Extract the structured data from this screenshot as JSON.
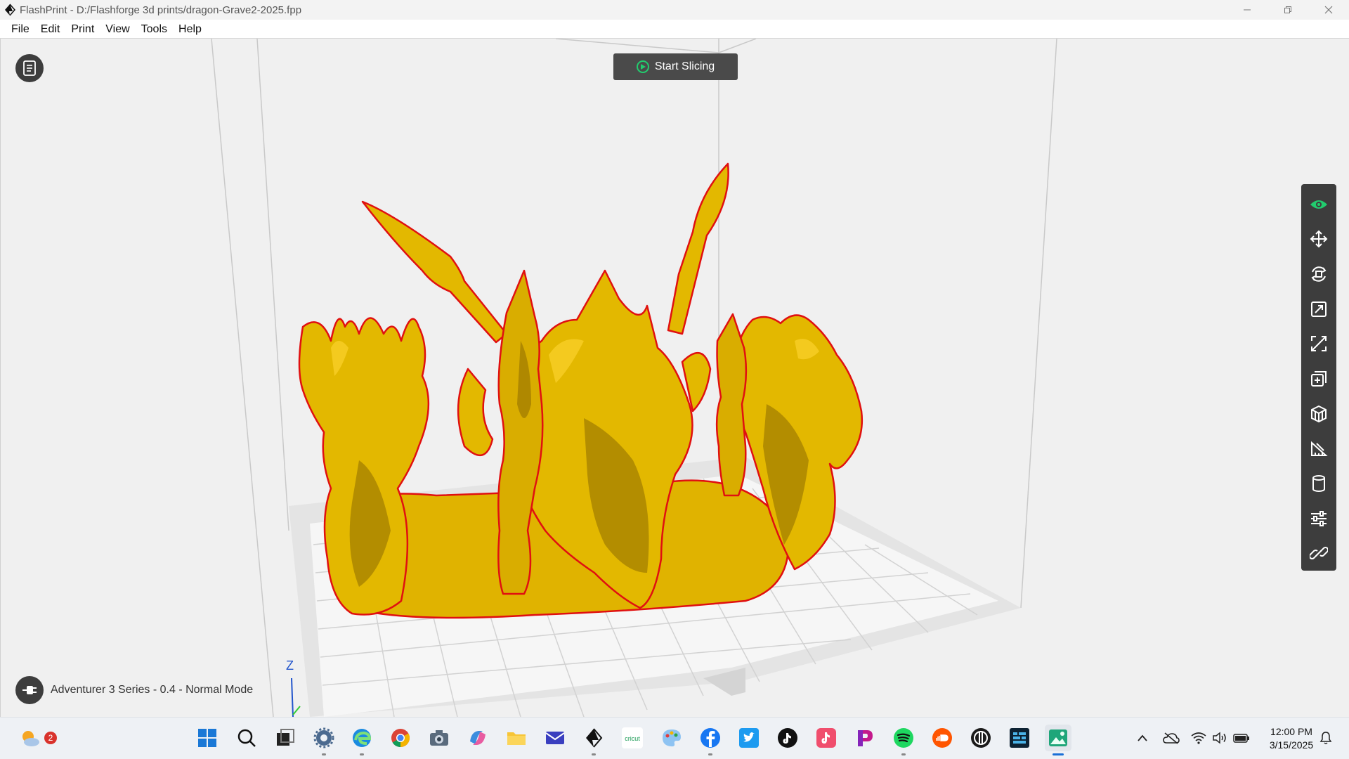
{
  "window": {
    "title": "FlashPrint - D:/Flashforge 3d prints/dragon-Grave2-2025.fpp",
    "minimize_icon": "minimize-icon",
    "restore_icon": "restore-icon",
    "close_icon": "close-icon"
  },
  "menu": {
    "items": [
      {
        "label": "File"
      },
      {
        "label": "Edit"
      },
      {
        "label": "Print"
      },
      {
        "label": "View"
      },
      {
        "label": "Tools"
      },
      {
        "label": "Help"
      }
    ]
  },
  "viewport": {
    "start_slicing_label": "Start Slicing",
    "machine_info": "Adventurer 3 Series - 0.4 - Normal Mode",
    "axis_z_label": "Z",
    "model_color": "#e3b800",
    "model_outline_color": "#e01010",
    "accent_color": "#22cc6e"
  },
  "toolbar": {
    "tools": [
      {
        "name": "view",
        "icon": "eye-icon",
        "active": true
      },
      {
        "name": "move",
        "icon": "move-icon"
      },
      {
        "name": "rotate",
        "icon": "rotate-icon"
      },
      {
        "name": "scale",
        "icon": "scale-icon"
      },
      {
        "name": "cut",
        "icon": "cut-icon"
      },
      {
        "name": "extrude",
        "icon": "extrude-icon"
      },
      {
        "name": "support",
        "icon": "support-icon"
      },
      {
        "name": "measure",
        "icon": "measure-icon"
      },
      {
        "name": "material",
        "icon": "cylinder-icon"
      },
      {
        "name": "settings",
        "icon": "sliders-icon"
      },
      {
        "name": "link",
        "icon": "link-icon"
      }
    ]
  },
  "taskbar": {
    "weather_badge": "2",
    "apps": [
      {
        "name": "start",
        "icon": "windows-icon"
      },
      {
        "name": "search",
        "icon": "search-icon"
      },
      {
        "name": "task-view",
        "icon": "task-view-icon"
      },
      {
        "name": "settings",
        "icon": "gear-icon"
      },
      {
        "name": "edge",
        "icon": "edge-icon"
      },
      {
        "name": "chrome",
        "icon": "chrome-icon"
      },
      {
        "name": "camera",
        "icon": "camera-icon"
      },
      {
        "name": "copilot",
        "icon": "copilot-icon"
      },
      {
        "name": "file-explorer",
        "icon": "folder-icon"
      },
      {
        "name": "mail",
        "icon": "mail-icon"
      },
      {
        "name": "flashprint",
        "icon": "flashprint-icon"
      },
      {
        "name": "cricut",
        "icon": "cricut-icon",
        "text": "cricut"
      },
      {
        "name": "paint",
        "icon": "palette-icon"
      },
      {
        "name": "facebook",
        "icon": "facebook-icon"
      },
      {
        "name": "twitter",
        "icon": "twitter-icon"
      },
      {
        "name": "tiktok",
        "icon": "tiktok-icon"
      },
      {
        "name": "tiktok-2",
        "icon": "tiktok-icon"
      },
      {
        "name": "picsart",
        "icon": "picsart-icon"
      },
      {
        "name": "spotify",
        "icon": "spotify-icon"
      },
      {
        "name": "soundcloud",
        "icon": "soundcloud-icon"
      },
      {
        "name": "app-circle",
        "icon": "circle-app-icon"
      },
      {
        "name": "app-dark",
        "icon": "dark-app-icon"
      },
      {
        "name": "photos",
        "icon": "photos-icon",
        "active": true
      }
    ],
    "tray": {
      "chevron_icon": "chevron-up-icon",
      "onedrive_icon": "cloud-off-icon",
      "wifi_icon": "wifi-icon",
      "volume_icon": "volume-icon",
      "battery_icon": "battery-icon",
      "notification_icon": "notification-icon"
    },
    "clock": {
      "time": "12:00 PM",
      "date": "3/15/2025"
    }
  }
}
